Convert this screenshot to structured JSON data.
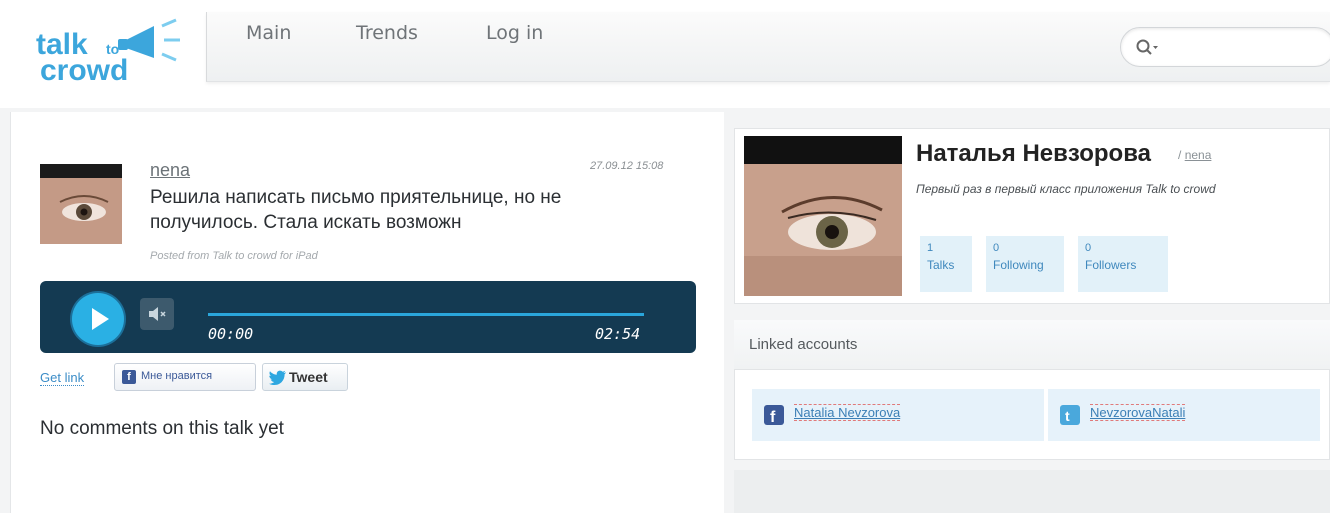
{
  "app": {
    "logo_text_top": "talk",
    "logo_text_to": "to",
    "logo_text_bottom": "crowd"
  },
  "nav": {
    "items": [
      {
        "label": "Main"
      },
      {
        "label": "Trends"
      },
      {
        "label": "Log in"
      }
    ]
  },
  "search": {
    "placeholder": "",
    "value": ""
  },
  "talk": {
    "username": "nena",
    "timestamp": "27.09.12 15:08",
    "text": "Решила написать письмо приятельнице, но не получилось. Стала искать возможн",
    "posted_from": "Posted from Talk to crowd for iPad",
    "player": {
      "current_time": "00:00",
      "total_time": "02:54"
    },
    "get_link": "Get link",
    "like_label": "Мне нравится",
    "tweet_label": "Tweet",
    "no_comments": "No comments on this talk yet"
  },
  "profile": {
    "name": "Наталья Невзорова",
    "handle_prefix": "/",
    "handle": "nena",
    "bio": "Первый раз в первый класс приложения Talk to crowd",
    "stats": [
      {
        "value": "1",
        "label": "Talks"
      },
      {
        "value": "0",
        "label": "Following"
      },
      {
        "value": "0",
        "label": "Followers"
      }
    ]
  },
  "linked_accounts": {
    "title": "Linked accounts",
    "accounts": [
      {
        "service": "facebook",
        "name": "Natalia Nevzorova"
      },
      {
        "service": "twitter",
        "name": "NevzorovaNatali"
      }
    ]
  },
  "colors": {
    "brand_blue": "#2ab0e4",
    "player_bg": "#143a52",
    "link_blue": "#3b8cc7",
    "stat_bg": "#e2f1f9"
  }
}
